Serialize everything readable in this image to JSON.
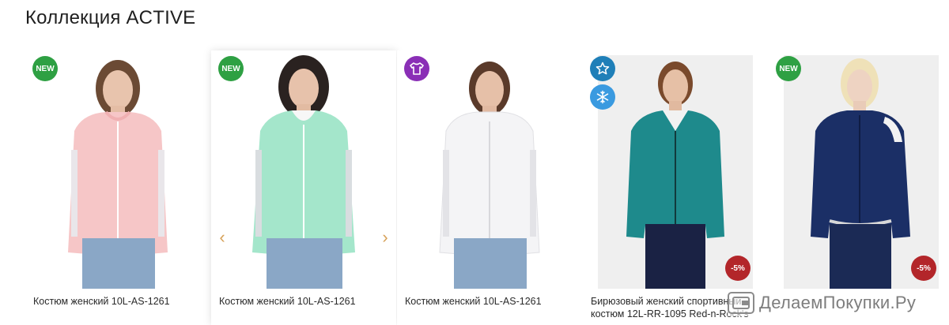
{
  "section": {
    "title": "Коллекция ACTIVE"
  },
  "products": [
    {
      "title": "Костюм женский 10L-AS-1261",
      "badges": [
        "NEW"
      ],
      "jacket_color": "#f6c6c7",
      "pants_color": "#8aa7c6"
    },
    {
      "title": "Костюм женский 10L-AS-1261",
      "badges": [
        "NEW"
      ],
      "jacket_color": "#a4e6cb",
      "pants_color": "#8aa7c6"
    },
    {
      "title": "Костюм женский 10L-AS-1261",
      "badges": [
        "shirt-icon"
      ],
      "jacket_color": "#f4f4f6",
      "pants_color": "#8aa7c6"
    },
    {
      "title": "Бирюзовый женский спортивный костюм 12L-RR-1095 Red-n-Rock's",
      "badges": [
        "star-icon",
        "snowflake-icon"
      ],
      "sale": "-5%",
      "jacket_color": "#1e8a8c",
      "pants_color": "#1a2244"
    },
    {
      "title": "",
      "badges": [
        "NEW"
      ],
      "sale": "-5%",
      "jacket_color": "#1b2f66",
      "pants_color": "#1b2a55"
    }
  ],
  "carousel": {
    "prev_icon": "chevron-left-icon",
    "next_icon": "chevron-right-icon",
    "accent": "#d7a25a"
  },
  "watermark": {
    "text": "ДелаемПокупки.Ру",
    "logo_icon": "wallet-icon"
  },
  "colors": {
    "new_badge": "#2ea043",
    "sale_badge": "#b3262a",
    "shirt_badge": "#8a2fb6",
    "star_badge": "#1f7fb8",
    "snow_badge": "#3a9ae0"
  }
}
